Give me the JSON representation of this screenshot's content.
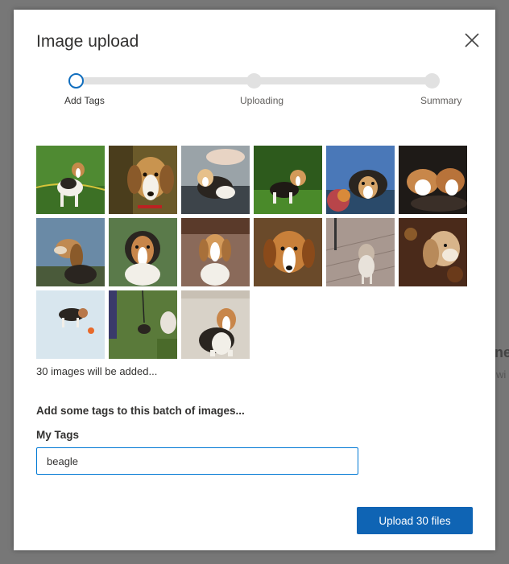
{
  "background": {
    "text_1": "ne",
    "text_2": "wi"
  },
  "dialog": {
    "title": "Image upload",
    "close_icon": "close-icon"
  },
  "stepper": {
    "steps": [
      {
        "label": "Add Tags",
        "state": "active"
      },
      {
        "label": "Uploading",
        "state": "pending"
      },
      {
        "label": "Summary",
        "state": "pending"
      }
    ],
    "accent_color": "#106ebe"
  },
  "images": {
    "thumbnail_count_shown": 15,
    "count_text": "30 images will be added..."
  },
  "tags": {
    "prompt": "Add some tags to this batch of images...",
    "label": "My Tags",
    "value": "beagle"
  },
  "actions": {
    "upload_label": "Upload 30 files",
    "button_color": "#0f64b4"
  }
}
